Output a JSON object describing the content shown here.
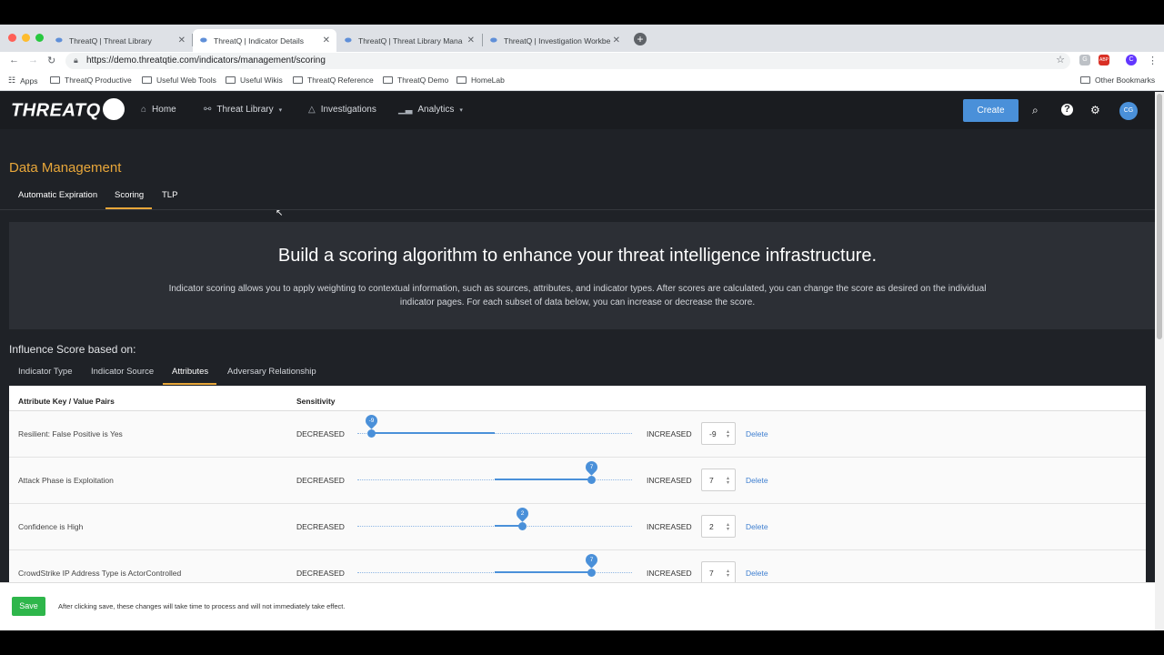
{
  "browser": {
    "tabs": [
      {
        "title": "ThreatQ | Threat Library",
        "active": false
      },
      {
        "title": "ThreatQ | Indicator Details",
        "active": true
      },
      {
        "title": "ThreatQ | Threat Library Mana",
        "active": false
      },
      {
        "title": "ThreatQ | Investigation Workbe",
        "active": false
      }
    ],
    "url": "https://demo.threatqtie.com/indicators/management/scoring",
    "bookmarks": [
      "Apps",
      "ThreatQ Productive",
      "Useful Web Tools",
      "Useful Wikis",
      "ThreatQ Reference",
      "ThreatQ Demo",
      "HomeLab",
      "Other Bookmarks"
    ],
    "extensions": [
      "G",
      "ABP",
      "C"
    ]
  },
  "app": {
    "logo": "THREATQ",
    "nav": [
      {
        "label": "Home",
        "icon": "home-icon"
      },
      {
        "label": "Threat Library",
        "icon": "binoculars-icon",
        "dropdown": true
      },
      {
        "label": "Investigations",
        "icon": "network-icon"
      },
      {
        "label": "Analytics",
        "icon": "bar-chart-icon",
        "dropdown": true
      }
    ],
    "create_label": "Create",
    "user_initials": "CG"
  },
  "page": {
    "title": "Data Management",
    "subtabs": [
      "Automatic Expiration",
      "Scoring",
      "TLP"
    ],
    "active_subtab": "Scoring",
    "hero_title": "Build a scoring algorithm to enhance your threat intelligence infrastructure.",
    "hero_desc": "Indicator scoring allows you to apply weighting to contextual information, such as sources, attributes, and indicator types. After scores are calculated, you can change the score as desired on the individual indicator pages. For each subset of data below, you can increase or decrease the score.",
    "influence_heading": "Influence Score based on:",
    "influence_tabs": [
      "Indicator Type",
      "Indicator Source",
      "Attributes",
      "Adversary Relationship"
    ],
    "active_influence_tab": "Attributes"
  },
  "table": {
    "col_key": "Attribute Key / Value Pairs",
    "col_sensitivity": "Sensitivity",
    "decreased_label": "DECREASED",
    "increased_label": "INCREASED",
    "delete_label": "Delete",
    "slider_min": -10,
    "slider_max": 10,
    "rows": [
      {
        "label": "Resilient: False Positive is Yes",
        "value": -9
      },
      {
        "label": "Attack Phase is Exploitation",
        "value": 7
      },
      {
        "label": "Confidence is High",
        "value": 2
      },
      {
        "label": "CrowdStrike IP Address Type is ActorControlled",
        "value": 7
      }
    ]
  },
  "footer": {
    "save_label": "Save",
    "note": "After clicking save, these changes will take time to process and will not immediately take effect."
  }
}
